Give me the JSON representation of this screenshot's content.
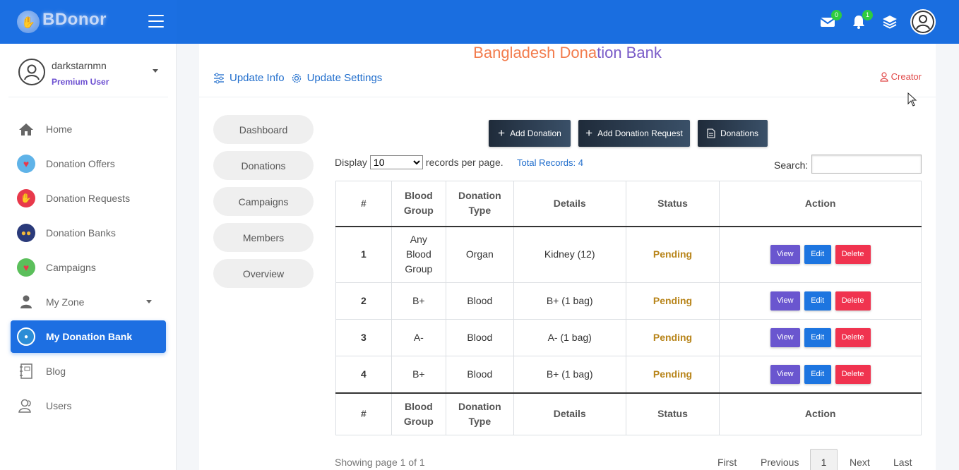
{
  "brand": {
    "name": "BDonor"
  },
  "header": {
    "mail_count": "0",
    "notification_count": "1"
  },
  "user": {
    "name": "darkstarnmn",
    "role": "Premium User"
  },
  "sidebar": {
    "items": [
      {
        "label": "Home",
        "icon": "home-icon"
      },
      {
        "label": "Donation Offers",
        "icon": "heart-hand-icon"
      },
      {
        "label": "Donation Requests",
        "icon": "blood-drop-icon"
      },
      {
        "label": "Donation Banks",
        "icon": "people-icon"
      },
      {
        "label": "Campaigns",
        "icon": "campaign-icon"
      },
      {
        "label": "My Zone",
        "icon": "person-icon"
      },
      {
        "label": "My Donation Bank",
        "icon": "bank-badge-icon"
      },
      {
        "label": "Blog",
        "icon": "notebook-icon"
      },
      {
        "label": "Users",
        "icon": "users-icon"
      }
    ]
  },
  "main": {
    "title_part1": "Bangladesh Dona",
    "title_part2": "tion Bank",
    "update_info": "Update Info",
    "update_settings": "Update Settings",
    "creator": "Creator",
    "tabs": [
      "Dashboard",
      "Donations",
      "Campaigns",
      "Members",
      "Overview"
    ],
    "buttons": {
      "add_donation": "Add Donation",
      "add_request": "Add Donation Request",
      "donations": "Donations"
    },
    "display_label": "Display",
    "records_per_page": "10",
    "records_suffix": "records per page.",
    "total_records": "Total Records: 4",
    "search_label": "Search:"
  },
  "table": {
    "headers": [
      "#",
      "Blood Group",
      "Donation Type",
      "Details",
      "Status",
      "Action"
    ],
    "rows": [
      {
        "num": "1",
        "blood_group": "Any Blood Group",
        "type": "Organ",
        "details": "Kidney (12)",
        "status": "Pending"
      },
      {
        "num": "2",
        "blood_group": "B+",
        "type": "Blood",
        "details": "B+ (1 bag)",
        "status": "Pending"
      },
      {
        "num": "3",
        "blood_group": "A-",
        "type": "Blood",
        "details": "A- (1 bag)",
        "status": "Pending"
      },
      {
        "num": "4",
        "blood_group": "B+",
        "type": "Blood",
        "details": "B+ (1 bag)",
        "status": "Pending"
      }
    ],
    "actions": {
      "view": "View",
      "edit": "Edit",
      "delete": "Delete"
    }
  },
  "pagination": {
    "showing": "Showing page 1 of 1",
    "first": "First",
    "previous": "Previous",
    "current": "1",
    "next": "Next",
    "last": "Last"
  },
  "colors": {
    "primary": "#1d6fe2",
    "pending": "#b8851b",
    "view": "#6a56cf",
    "delete": "#f0334f"
  }
}
